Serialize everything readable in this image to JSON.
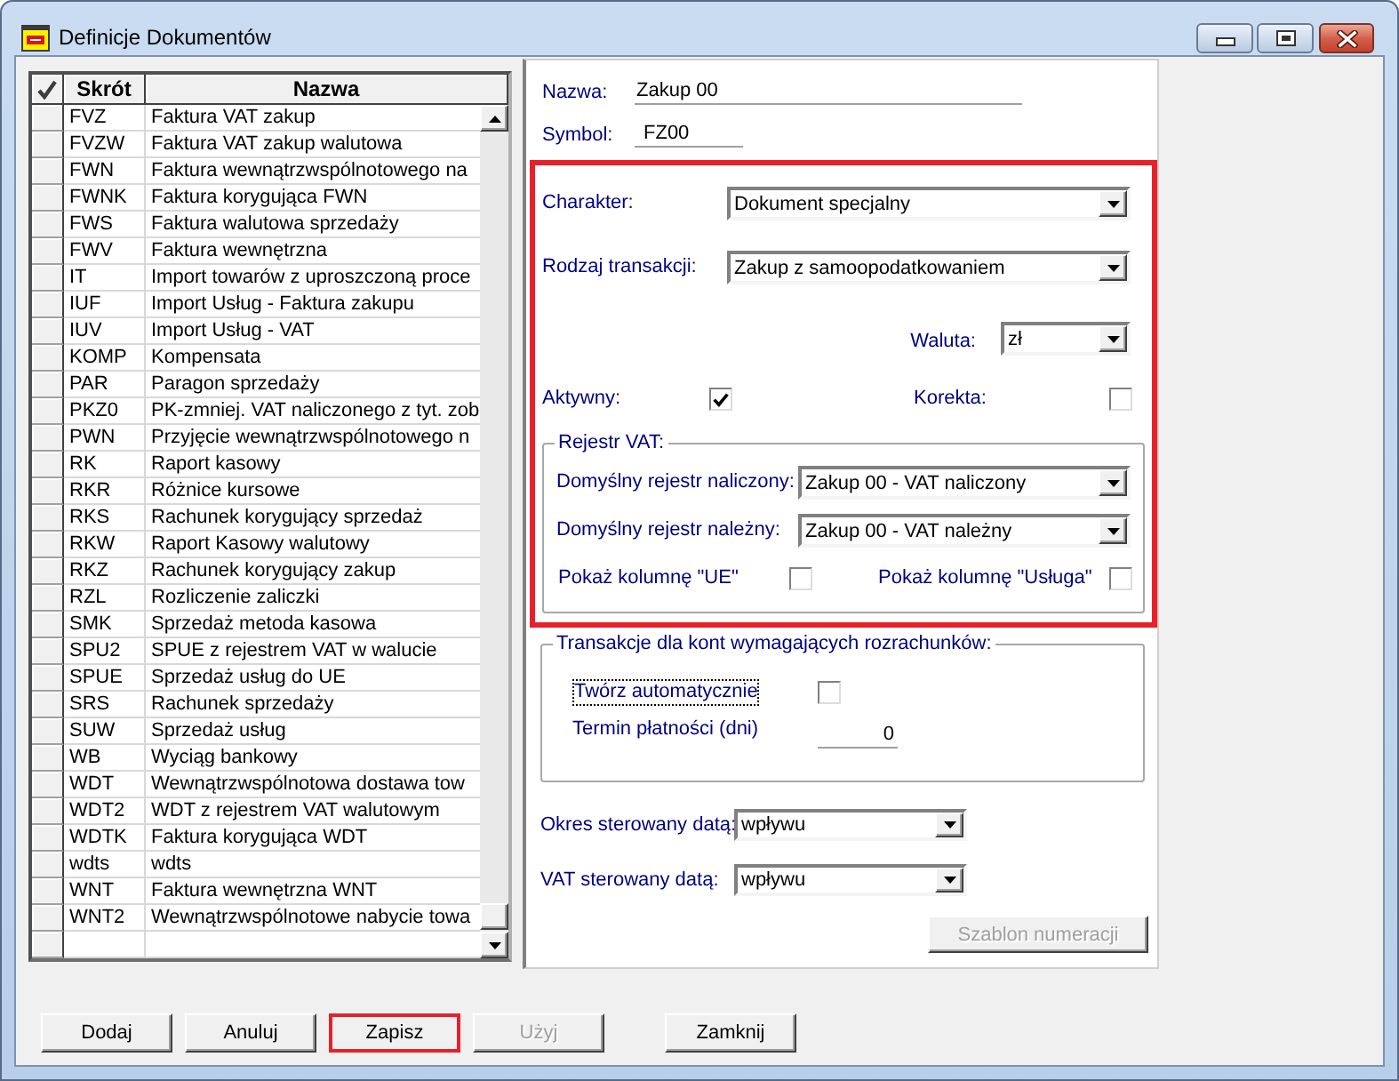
{
  "window": {
    "title": "Definicje Dokumentów"
  },
  "table": {
    "columns": [
      "Skrót",
      "Nazwa"
    ],
    "rows": [
      {
        "code": "FVZ",
        "name": "Faktura VAT zakup"
      },
      {
        "code": "FVZW",
        "name": "Faktura VAT zakup walutowa"
      },
      {
        "code": "FWN",
        "name": "Faktura wewnątrzwspólnotowego na"
      },
      {
        "code": "FWNK",
        "name": "Faktura korygująca FWN"
      },
      {
        "code": "FWS",
        "name": "Faktura walutowa sprzedaży"
      },
      {
        "code": "FWV",
        "name": "Faktura wewnętrzna"
      },
      {
        "code": "IT",
        "name": "Import towarów z uproszczoną proce"
      },
      {
        "code": "IUF",
        "name": "Import Usług - Faktura zakupu"
      },
      {
        "code": "IUV",
        "name": "Import Usług - VAT"
      },
      {
        "code": "KOMP",
        "name": "Kompensata"
      },
      {
        "code": "PAR",
        "name": "Paragon sprzedaży"
      },
      {
        "code": "PKZ0",
        "name": "PK-zmniej. VAT naliczonego z tyt. zob"
      },
      {
        "code": "PWN",
        "name": "Przyjęcie wewnątrzwspólnotowego n"
      },
      {
        "code": "RK",
        "name": "Raport kasowy"
      },
      {
        "code": "RKR",
        "name": "Różnice kursowe"
      },
      {
        "code": "RKS",
        "name": "Rachunek korygujący sprzedaż"
      },
      {
        "code": "RKW",
        "name": "Raport Kasowy walutowy"
      },
      {
        "code": "RKZ",
        "name": "Rachunek korygujący zakup"
      },
      {
        "code": "RZL",
        "name": "Rozliczenie zaliczki"
      },
      {
        "code": "SMK",
        "name": "Sprzedaż metoda kasowa"
      },
      {
        "code": "SPU2",
        "name": "SPUE z rejestrem VAT w walucie"
      },
      {
        "code": "SPUE",
        "name": "Sprzedaż usług do UE"
      },
      {
        "code": "SRS",
        "name": "Rachunek sprzedaży"
      },
      {
        "code": "SUW",
        "name": "Sprzedaż usług"
      },
      {
        "code": "WB",
        "name": "Wyciąg bankowy"
      },
      {
        "code": "WDT",
        "name": "Wewnątrzwspólnotowa dostawa tow"
      },
      {
        "code": "WDT2",
        "name": "WDT z rejestrem VAT walutowym"
      },
      {
        "code": "WDTK",
        "name": "Faktura korygująca WDT"
      },
      {
        "code": "wdts",
        "name": "wdts"
      },
      {
        "code": "WNT",
        "name": "Faktura wewnętrzna WNT"
      },
      {
        "code": "WNT2",
        "name": "Wewnątrzwspólnotowe nabycie towa"
      }
    ]
  },
  "form": {
    "name": {
      "label": "Nazwa:",
      "value": "Zakup 00"
    },
    "symbol": {
      "label": "Symbol:",
      "value": "FZ00"
    },
    "main_section": {
      "highlighted": true,
      "character": {
        "label": "Charakter:",
        "value": "Dokument specjalny"
      },
      "transaction_type": {
        "label": "Rodzaj transakcji:",
        "value": "Zakup z samoopodatkowaniem"
      },
      "currency": {
        "label": "Waluta:",
        "value": "zł"
      },
      "active": {
        "label": "Aktywny:",
        "checked": true
      },
      "correction": {
        "label": "Korekta:",
        "checked": false
      },
      "vat_register": {
        "title": "Rejestr VAT:",
        "input_register": {
          "label": "Domyślny rejestr naliczony:",
          "value": "Zakup 00 - VAT naliczony"
        },
        "output_register": {
          "label": "Domyślny rejestr należny:",
          "value": "Zakup 00 - VAT należny"
        },
        "show_ue": {
          "label": "Pokaż kolumnę \"UE\"",
          "checked": false
        },
        "show_service": {
          "label": "Pokaż kolumnę \"Usługa\"",
          "checked": false
        }
      }
    },
    "settlements": {
      "title": "Transakcje dla kont wymagających rozrachunków:",
      "auto_create": {
        "label": "Twórz automatycznie",
        "checked": false,
        "focused": true
      },
      "payment_term": {
        "label": "Termin płatności (dni)",
        "value": "0"
      }
    },
    "period_date": {
      "label": "Okres sterowany datą:",
      "value": "wpływu"
    },
    "vat_date": {
      "label": "VAT sterowany datą:",
      "value": "wpływu"
    },
    "numbering_button": {
      "label": "Szablon numeracji",
      "disabled": true
    }
  },
  "buttons": [
    {
      "label": "Dodaj",
      "disabled": false,
      "highlighted": false
    },
    {
      "label": "Anuluj",
      "disabled": false,
      "highlighted": false
    },
    {
      "label": "Zapisz",
      "disabled": false,
      "highlighted": true
    },
    {
      "label": "Użyj",
      "disabled": true,
      "highlighted": false
    },
    {
      "label": "Zamknij",
      "disabled": false,
      "highlighted": false
    }
  ]
}
